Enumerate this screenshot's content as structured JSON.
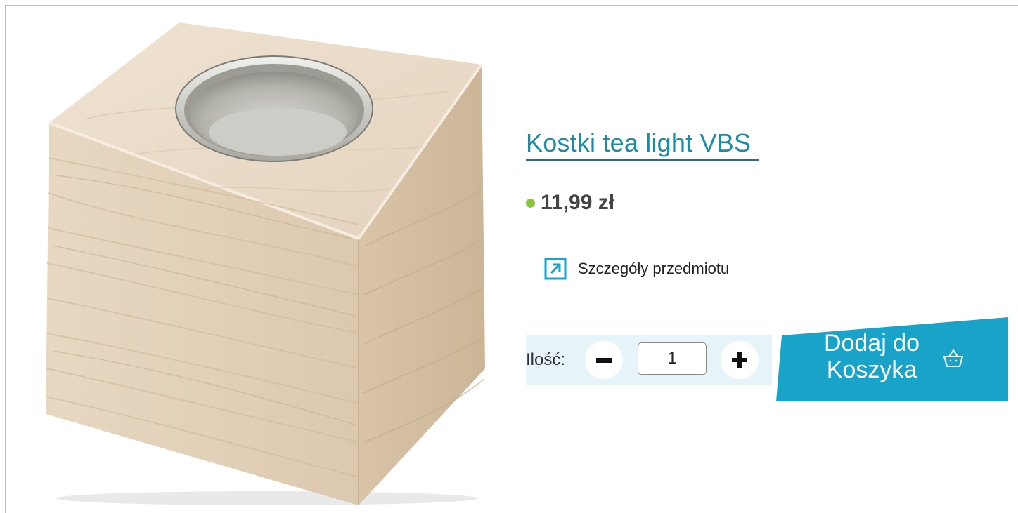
{
  "product": {
    "title": "Kostki tea light VBS",
    "price": "11,99 zł",
    "availability_color": "#8cc63f",
    "details_label": "Szczegóły przedmiotu",
    "image_icon": "wooden-tealight-cube-image"
  },
  "quantity": {
    "label": "Ilość:",
    "value": "1",
    "minus_icon": "minus-icon",
    "plus_icon": "plus-icon"
  },
  "cart": {
    "button_label": "Dodaj do Koszyka",
    "icon": "basket-icon",
    "color": "#1aa3c8"
  },
  "colors": {
    "link": "#1e8ba3",
    "qty_background": "#e6f4fa",
    "accent": "#1aa3c8"
  }
}
